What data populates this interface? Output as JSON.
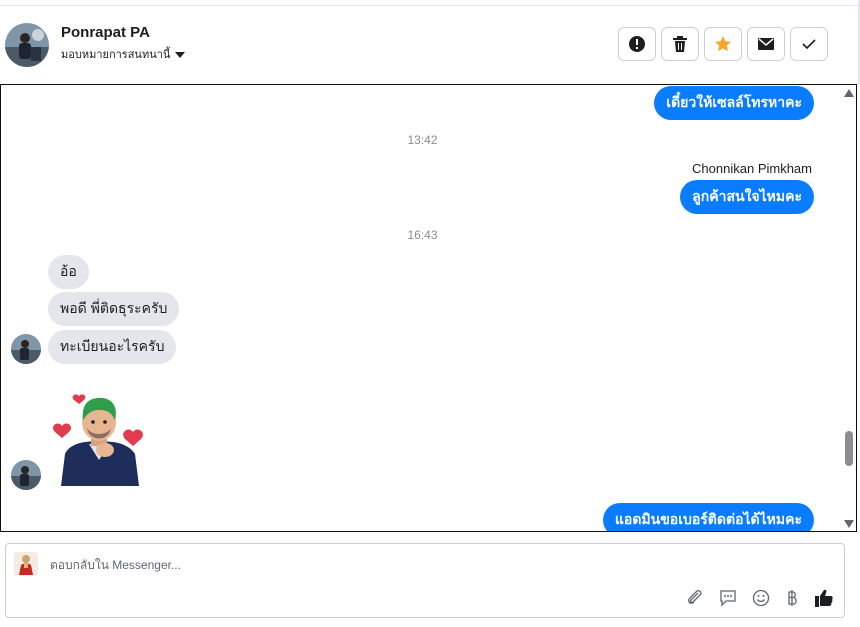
{
  "contact": {
    "name": "Ponrapat PA",
    "assign_label": "มอบหมายการสนทนานี้"
  },
  "header_actions": [
    {
      "icon": "alert-icon",
      "color": "#1c1e21"
    },
    {
      "icon": "trash-icon",
      "color": "#1c1e21"
    },
    {
      "icon": "star-icon",
      "color": "#f5a623"
    },
    {
      "icon": "mail-icon",
      "color": "#1c1e21"
    },
    {
      "icon": "check-icon",
      "color": "#1c1e21"
    }
  ],
  "messages": {
    "out_1": "เดี๋ยวให้เซลล์โทรหาคะ",
    "time_1": "13:42",
    "sender_1": "Chonnikan Pimkham",
    "out_2": "ลูกค้าสนใจไหมคะ",
    "time_2": "16:43",
    "in_1": "อ้อ",
    "in_2": "พอดี พี่ติดธุระครับ",
    "in_3": "ทะเบียนอะไรครับ",
    "out_3": "แอดมินขอเบอร์ติดต่อได้ไหมคะ"
  },
  "composer": {
    "placeholder": "ตอบกลับใน Messenger...",
    "tools": [
      "paperclip-icon",
      "speech-bubble-icon",
      "smiley-icon",
      "baht-icon",
      "thumbs-up-icon"
    ]
  },
  "colors": {
    "outgoing_bubble": "#0a7cff",
    "incoming_bubble": "#e4e6eb",
    "star": "#f5a623",
    "like": "#1c1e21"
  }
}
